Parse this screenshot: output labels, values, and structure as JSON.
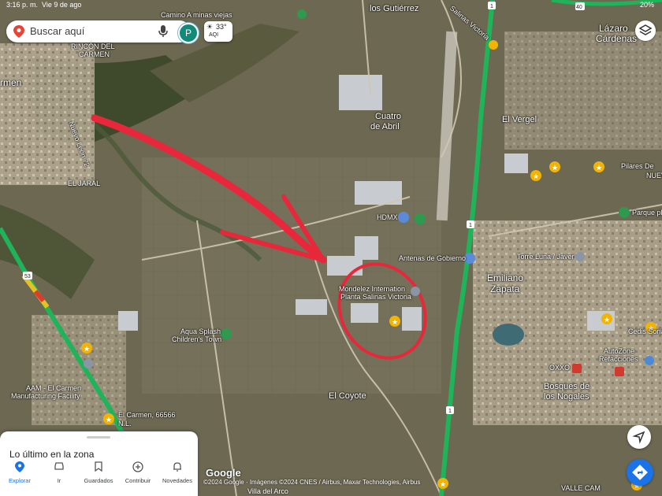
{
  "status": {
    "time": "3:16 p. m.",
    "date": "Vie 9 de ago",
    "battery": "20%"
  },
  "search": {
    "placeholder": "Buscar aquí",
    "avatar_letter": "P"
  },
  "weather": {
    "temp": "33°",
    "aqi": "AQI"
  },
  "places": {
    "camino": "Camino A minas viejas",
    "gutierrez": "los Gutiérrez",
    "rincon": "RINCÓN DEL",
    "carmen_small": "CARMEN",
    "carmen": "rmen",
    "cuatro": "Cuatro",
    "abril": "de Abril",
    "lazaro1": "Lázaro",
    "lazaro2": "Cárdenas",
    "vergel": "El Vergel",
    "pilares1": "Pilares De",
    "pilares2": "NUEV",
    "parque": "Parque pl",
    "hdmx": "HDMX",
    "antenas": "Antenas de Gobierno",
    "torre": "Torre Luna / Javer",
    "emiliano1": "Emiliano",
    "emiliano2": "Zapata",
    "mondelez1": "Mondelez Internation",
    "mondelez2": "Planta Salinas Victoria",
    "aqua1": "Aqua Splash",
    "aqua2": "Children's Town",
    "aam1": "AAM - El Carmen",
    "aam2": "Manufacturing Facility",
    "elcarmen1": "El Carmen, 66566",
    "elcarmen2": "N.L.",
    "coyote": "El Coyote",
    "cedis": "Cedis Soria",
    "autozone1": "AutoZone",
    "autozone2": "Refacciones",
    "oxxo": "OXXO",
    "bosques1": "Bosques de",
    "bosques2": "los Nogales",
    "jaral": "EL JARAL",
    "valle": "VALLE CAM",
    "villa": "Villa del Arco",
    "road_salinas": "Salinas Victoria",
    "road_nl": "Nuevo León 72"
  },
  "panel": {
    "title": "Lo último en la zona"
  },
  "nav": [
    {
      "label": "Explorar",
      "icon": "explore-pin-icon"
    },
    {
      "label": "Ir",
      "icon": "car-icon"
    },
    {
      "label": "Guardados",
      "icon": "bookmark-icon"
    },
    {
      "label": "Contribuir",
      "icon": "add-circle-icon"
    },
    {
      "label": "Novedades",
      "icon": "bell-icon"
    }
  ],
  "attribution": {
    "logo": "Google",
    "text": "©2024 Google · Imágenes ©2024 CNES / Airbus, Maxar Technologies, Airbus"
  },
  "route_markers": [
    "53",
    "1",
    "1",
    "1",
    "40"
  ],
  "colors": {
    "annotation": "#e8273a",
    "route": "#1fb35a",
    "accent": "#1a73e8"
  }
}
